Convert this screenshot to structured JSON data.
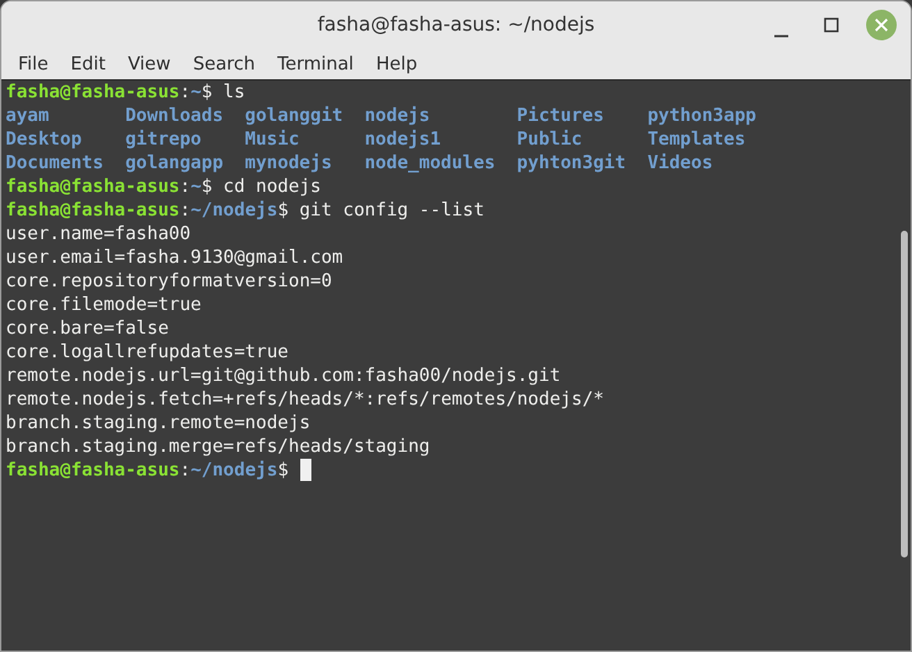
{
  "window": {
    "title": "fasha@fasha-asus: ~/nodejs"
  },
  "menu": [
    "File",
    "Edit",
    "View",
    "Search",
    "Terminal",
    "Help"
  ],
  "lines": [
    {
      "kind": "prompt",
      "user": "fasha@fasha-asus",
      "sep": ":",
      "path": "~",
      "dollar": "$",
      "command": "ls"
    },
    {
      "kind": "listing",
      "entries": [
        "ayam",
        "Downloads",
        "golanggit",
        "nodejs",
        "Pictures",
        "python3app"
      ]
    },
    {
      "kind": "listing",
      "entries": [
        "Desktop",
        "gitrepo",
        "Music",
        "nodejs1",
        "Public",
        "Templates"
      ]
    },
    {
      "kind": "listing",
      "entries": [
        "Documents",
        "golangapp",
        "mynodejs",
        "node_modules",
        "pyhton3git",
        "Videos"
      ]
    },
    {
      "kind": "prompt",
      "user": "fasha@fasha-asus",
      "sep": ":",
      "path": "~",
      "dollar": "$",
      "command": "cd nodejs"
    },
    {
      "kind": "prompt",
      "user": "fasha@fasha-asus",
      "sep": ":",
      "path": "~/nodejs",
      "dollar": "$",
      "command": "git config --list"
    },
    {
      "kind": "output",
      "text": "user.name=fasha00"
    },
    {
      "kind": "output",
      "text": "user.email=fasha.9130@gmail.com"
    },
    {
      "kind": "output",
      "text": "core.repositoryformatversion=0"
    },
    {
      "kind": "output",
      "text": "core.filemode=true"
    },
    {
      "kind": "output",
      "text": "core.bare=false"
    },
    {
      "kind": "output",
      "text": "core.logallrefupdates=true"
    },
    {
      "kind": "output",
      "text": "remote.nodejs.url=git@github.com:fasha00/nodejs.git"
    },
    {
      "kind": "output",
      "text": "remote.nodejs.fetch=+refs/heads/*:refs/remotes/nodejs/*"
    },
    {
      "kind": "output",
      "text": "branch.staging.remote=nodejs"
    },
    {
      "kind": "output",
      "text": "branch.staging.merge=refs/heads/staging"
    },
    {
      "kind": "prompt",
      "user": "fasha@fasha-asus",
      "sep": ":",
      "path": "~/nodejs",
      "dollar": "$",
      "cursor": true
    }
  ]
}
